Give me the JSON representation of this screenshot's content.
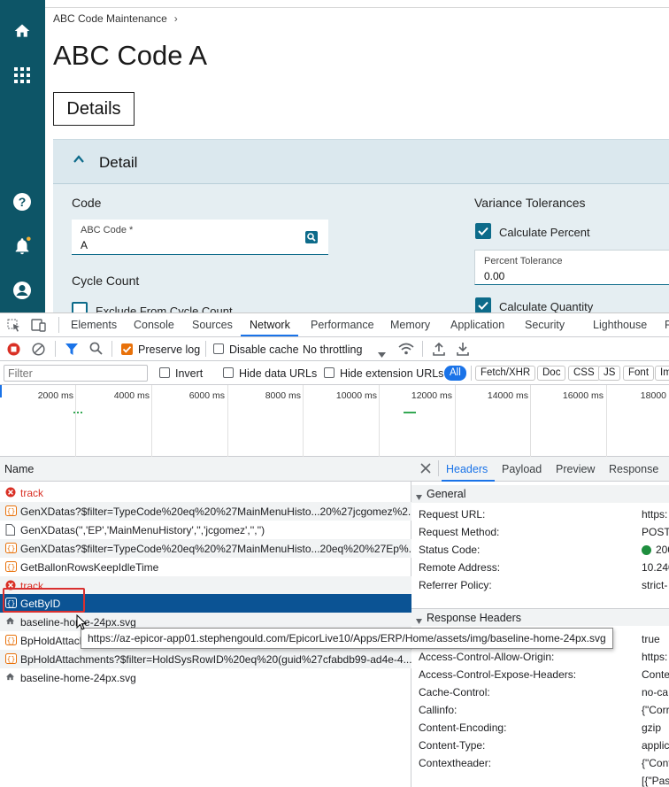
{
  "app": {
    "breadcrumb": "ABC Code Maintenance",
    "breadcrumb_chevron": "›",
    "page_title": "ABC Code A",
    "details_tab": "Details",
    "detail_section_title": "Detail",
    "code_section": "Code",
    "abc_code_label": "ABC Code *",
    "abc_code_value": "A",
    "cycle_count_section": "Cycle Count",
    "exclude_cycle_count_label": "Exclude From Cycle Count",
    "variance_section": "Variance Tolerances",
    "calculate_percent_label": "Calculate Percent",
    "percent_tolerance_label": "Percent Tolerance",
    "percent_tolerance_value": "0.00",
    "calculate_quantity_label": "Calculate Quantity",
    "colors": {
      "nav": "#0d5567",
      "accent": "#0d6b8a"
    }
  },
  "devtools": {
    "tabs": [
      "Elements",
      "Console",
      "Sources",
      "Network",
      "Performance",
      "Memory",
      "Application",
      "Security",
      "Lighthouse",
      "R"
    ],
    "active_tab": "Network",
    "toolbar": {
      "preserve_log": "Preserve log",
      "disable_cache": "Disable cache",
      "throttling": "No throttling"
    },
    "filter": {
      "placeholder": "Filter",
      "invert": "Invert",
      "hide_data_urls": "Hide data URLs",
      "hide_extension_urls": "Hide extension URLs",
      "types": [
        "All",
        "Fetch/XHR",
        "Doc",
        "CSS",
        "JS",
        "Font",
        "Im"
      ]
    },
    "timeline_ticks": [
      "2000 ms",
      "4000 ms",
      "6000 ms",
      "8000 ms",
      "10000 ms",
      "12000 ms",
      "14000 ms",
      "16000 ms",
      "18000"
    ],
    "name_header": "Name",
    "requests": [
      {
        "name": "track",
        "icon": "error-icon"
      },
      {
        "name": "GenXDatas?$filter=TypeCode%20eq%20%27MainMenuHisto...20%27jcgomez%2...",
        "icon": "xhr-icon"
      },
      {
        "name": "GenXDatas('','EP','MainMenuHistory','','jcgomez','','')",
        "icon": "document-icon"
      },
      {
        "name": "GenXDatas?$filter=TypeCode%20eq%20%27MainMenuHisto...20eq%20%27Ep%...",
        "icon": "xhr-icon"
      },
      {
        "name": "GetBallonRowsKeepIdleTime",
        "icon": "xhr-icon"
      },
      {
        "name": "track",
        "icon": "error-icon"
      },
      {
        "name": "GetByID",
        "icon": "xhr-icon"
      },
      {
        "name": "baseline-home-24px.svg",
        "icon": "home-icon"
      },
      {
        "name": "BpHoldAttachments",
        "icon": "xhr-icon"
      },
      {
        "name": "BpHoldAttachments?$filter=HoldSysRowID%20eq%20(guid%27cfabdb99-ad4e-4...",
        "icon": "xhr-icon"
      },
      {
        "name": "baseline-home-24px.svg",
        "icon": "home-icon"
      }
    ],
    "tooltip": "https://az-epicor-app01.stephengould.com/EpicorLive10/Apps/ERP/Home/assets/img/baseline-home-24px.svg",
    "detail_tabs": [
      "Headers",
      "Payload",
      "Preview",
      "Response"
    ],
    "general_section": "General",
    "general": [
      {
        "key": "Request URL:",
        "value": "https:"
      },
      {
        "key": "Request Method:",
        "value": "POST"
      },
      {
        "key": "Status Code:",
        "value": "200"
      },
      {
        "key": "Remote Address:",
        "value": "10.240"
      },
      {
        "key": "Referrer Policy:",
        "value": "strict-"
      }
    ],
    "response_section": "Response Headers",
    "response_headers": [
      {
        "key": "Access-Control-Allow-Credentials:",
        "value": "true"
      },
      {
        "key": "Access-Control-Allow-Origin:",
        "value": "https:"
      },
      {
        "key": "Access-Control-Expose-Headers:",
        "value": "Conte"
      },
      {
        "key": "Cache-Control:",
        "value": "no-ca"
      },
      {
        "key": "Callinfo:",
        "value": "{\"Corr"
      },
      {
        "key": "Content-Encoding:",
        "value": "gzip"
      },
      {
        "key": "Content-Type:",
        "value": "applic"
      },
      {
        "key": "Contextheader:",
        "value": "{\"Cont"
      },
      {
        "key": "",
        "value": "[{\"Pas"
      }
    ]
  }
}
